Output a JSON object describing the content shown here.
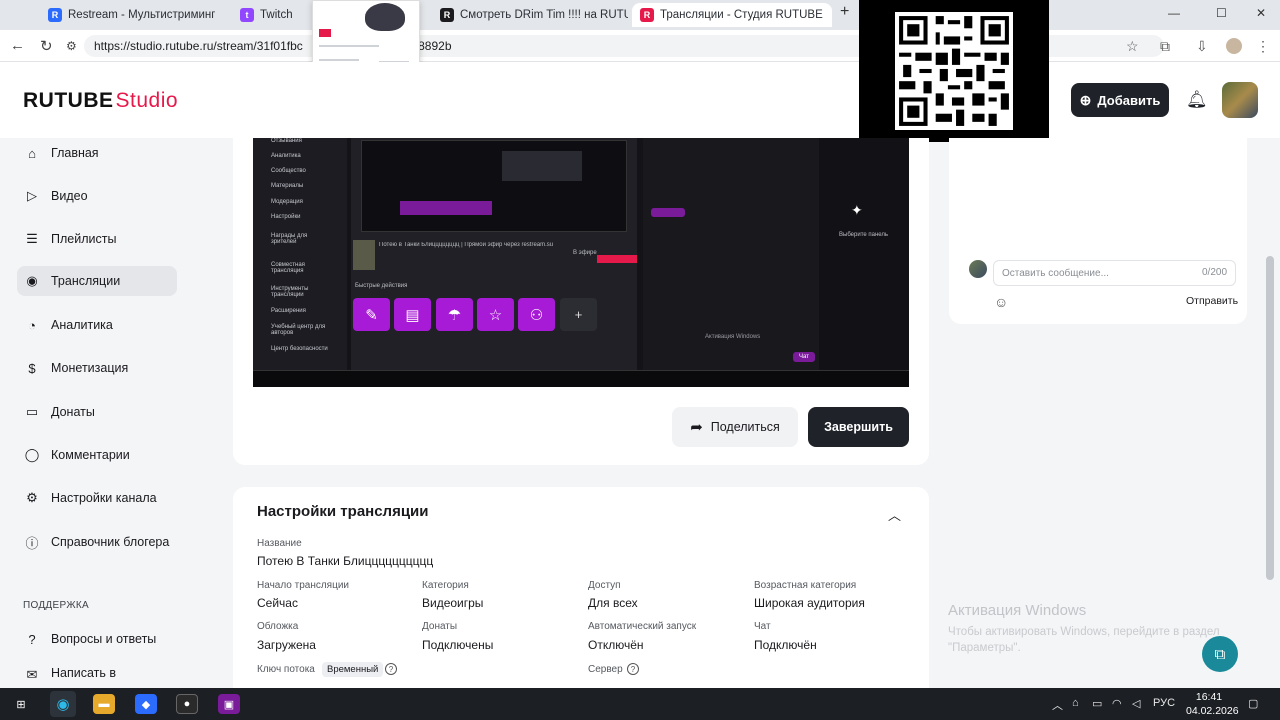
{
  "browser": {
    "tabs": [
      {
        "title": "Restream - Мультистриминг н",
        "favicon_color": "#2b6cff"
      },
      {
        "title": "Twitch",
        "favicon_color": "#9146ff"
      },
      {
        "title": "Смотреть DRim Tim !!!! на RUTU",
        "favicon_color": "#e6194b"
      },
      {
        "title": "Трансляции - Студия RUTUBE",
        "favicon_color": "#e6194b"
      }
    ],
    "url": "https://studio.rutube.ru/stream/31f01fbc",
    "url_tail": "8892b",
    "new_tab": "+",
    "window_controls": {
      "min": "—",
      "max": "☐",
      "close": "✕"
    }
  },
  "header": {
    "logo_main": "RUTUBE",
    "logo_accent": "Studio",
    "add_button": "Добавить",
    "accent_color": "#e6194b"
  },
  "sidebar": {
    "items": [
      {
        "label": "Главная",
        "icon": "home-icon"
      },
      {
        "label": "Видео",
        "icon": "video-icon"
      },
      {
        "label": "Плейлисты",
        "icon": "playlist-icon"
      },
      {
        "label": "Трансляции",
        "icon": "broadcast-icon",
        "active": true
      },
      {
        "label": "Аналитика",
        "icon": "analytics-icon"
      },
      {
        "label": "Монетизация",
        "icon": "monetization-icon"
      },
      {
        "label": "Донаты",
        "icon": "donation-icon"
      },
      {
        "label": "Комментарии",
        "icon": "comments-icon"
      },
      {
        "label": "Настройки канала",
        "icon": "settings-icon"
      },
      {
        "label": "Справочник блогера",
        "icon": "info-icon"
      }
    ],
    "support_section": "ПОДДЕРЖКА",
    "support_items": [
      {
        "label": "Вопросы и ответы",
        "icon": "help-icon"
      },
      {
        "label": "Написать в",
        "icon": "chat-icon"
      }
    ]
  },
  "preview": {
    "left_menu": [
      "Отзывания",
      "Аналитика",
      "Сообщество",
      "Материалы",
      "Модерация",
      "Настройки",
      "Награды для зрителей",
      "Совместная трансляция",
      "Инструменты трансляции",
      "Расширения",
      "Учебный центр для авторов",
      "Центр безопасности"
    ],
    "stream_title": "Потею в Танки Блицццццццц | Прямой эфир через restream.su",
    "quick_actions": "Быстрые действия",
    "live_badge": "В эфире",
    "chat_prompt": "Выберите панель",
    "activation": "Активация Windows",
    "chat_send": "Чат",
    "plus": "+"
  },
  "actions": {
    "share": "Поделиться",
    "finish": "Завершить"
  },
  "settings": {
    "title": "Настройки трансляции",
    "name_label": "Название",
    "name_value": "Потею В Танки Блицццццццццц",
    "fields": [
      {
        "label": "Начало трансляции",
        "value": "Сейчас"
      },
      {
        "label": "Категория",
        "value": "Видеоигры"
      },
      {
        "label": "Доступ",
        "value": "Для всех"
      },
      {
        "label": "Возрастная категория",
        "value": "Широкая аудитория"
      },
      {
        "label": "Обложка",
        "value": "Загружена"
      },
      {
        "label": "Донаты",
        "value": "Подключены"
      },
      {
        "label": "Автоматический запуск",
        "value": "Отключён"
      },
      {
        "label": "Чат",
        "value": "Подключён"
      }
    ],
    "stream_key_label": "Ключ потока",
    "stream_key_badge": "Временный",
    "server_label": "Сервер"
  },
  "chat": {
    "placeholder": "Оставить сообщение...",
    "counter": "0/200",
    "send": "Отправить"
  },
  "windows": {
    "activation_title": "Активация Windows",
    "activation_text": "Чтобы активировать Windows, перейдите в раздел \"Параметры\".",
    "language": "РУС",
    "time": "16:41",
    "date": "04.02.2026"
  }
}
